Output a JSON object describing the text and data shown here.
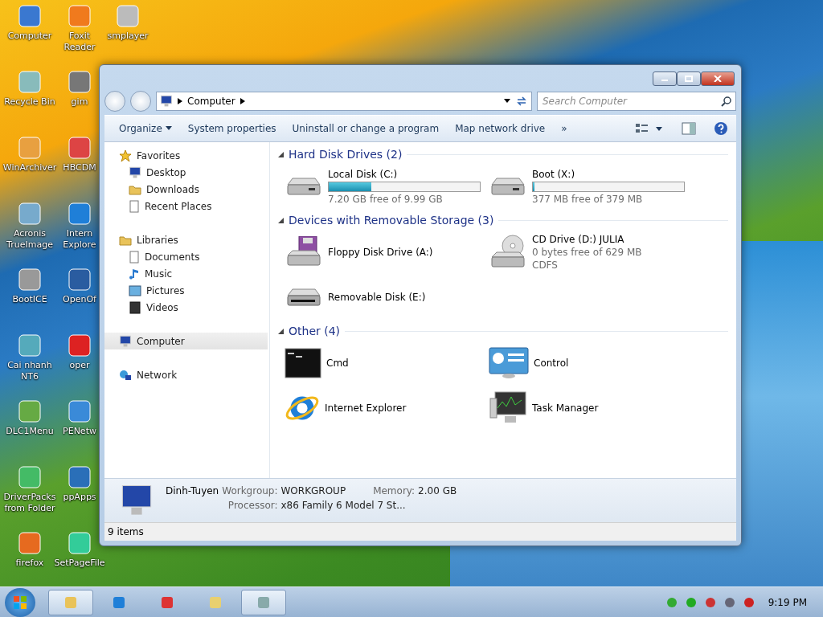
{
  "desktop_icons": [
    {
      "label": "Computer"
    },
    {
      "label": "Recycle Bin"
    },
    {
      "label": "WinArchiver"
    },
    {
      "label": "Acronis TrueImage"
    },
    {
      "label": "BootICE"
    },
    {
      "label": "Cai nhanh NT6"
    },
    {
      "label": "DLC1Menu"
    },
    {
      "label": "DriverPacks from Folder"
    },
    {
      "label": "firefox"
    },
    {
      "label": "Foxit Reader"
    },
    {
      "label": "gim"
    },
    {
      "label": "HBCDM"
    },
    {
      "label": "Intern Explore"
    },
    {
      "label": "OpenOf"
    },
    {
      "label": "oper"
    },
    {
      "label": "PENetw"
    },
    {
      "label": "ppApps"
    },
    {
      "label": "SetPageFile"
    },
    {
      "label": "smplayer"
    }
  ],
  "window": {
    "address": {
      "path": [
        "Computer"
      ]
    },
    "search": {
      "placeholder": "Search Computer"
    },
    "toolbar": [
      {
        "label": "Organize",
        "dropdown": true
      },
      {
        "label": "System properties",
        "dropdown": false
      },
      {
        "label": "Uninstall or change a program",
        "dropdown": false
      },
      {
        "label": "Map network drive",
        "dropdown": false
      },
      {
        "label": "»",
        "dropdown": false
      }
    ],
    "sidebar": [
      {
        "label": "Favorites",
        "selected": false,
        "children": [
          {
            "label": "Desktop",
            "selected": false
          },
          {
            "label": "Downloads",
            "selected": false
          },
          {
            "label": "Recent Places",
            "selected": false
          }
        ]
      },
      {
        "label": "Libraries",
        "selected": false,
        "children": [
          {
            "label": "Documents",
            "selected": false
          },
          {
            "label": "Music",
            "selected": false
          },
          {
            "label": "Pictures",
            "selected": false
          },
          {
            "label": "Videos",
            "selected": false
          }
        ]
      },
      {
        "label": "Computer",
        "selected": true
      },
      {
        "label": "Network",
        "selected": false
      }
    ],
    "sections": [
      {
        "title": "Hard Disk Drives (2)",
        "items": [
          {
            "kind": "drive",
            "name": "Local Disk (C:)",
            "level": 0.28,
            "details": [
              "7.20 GB free of 9.99 GB"
            ]
          },
          {
            "kind": "drive",
            "name": "Boot (X:)",
            "level": 0.01,
            "details": [
              "377 MB free of 379 MB"
            ]
          }
        ]
      },
      {
        "title": "Devices with Removable Storage (3)",
        "items": [
          {
            "kind": "device",
            "name": "Floppy Disk Drive (A:)"
          },
          {
            "kind": "device",
            "name": "CD Drive (D:) JULIA",
            "details": [
              "0 bytes free of 629 MB",
              "CDFS"
            ]
          },
          {
            "kind": "device",
            "name": "Removable Disk (E:)"
          }
        ]
      },
      {
        "title": "Other (4)",
        "items": [
          {
            "kind": "app",
            "name": "Cmd"
          },
          {
            "kind": "app",
            "name": "Control"
          },
          {
            "kind": "app",
            "name": "Internet Explorer"
          },
          {
            "kind": "app",
            "name": "Task Manager"
          }
        ]
      }
    ],
    "details_pane": {
      "name": "Dinh-Tuyen",
      "fields": [
        {
          "label": "Workgroup:",
          "value": "WORKGROUP"
        },
        {
          "label": "Memory:",
          "value": "2.00 GB"
        },
        {
          "label": "Processor:",
          "value": "x86 Family 6 Model 7 St..."
        }
      ]
    },
    "status_bar": "9 items"
  },
  "taskbar": {
    "buttons": [
      {
        "selected": true
      },
      {
        "selected": false
      },
      {
        "selected": false
      },
      {
        "selected": false
      },
      {
        "selected": true
      }
    ],
    "clock": "9:19 PM"
  }
}
